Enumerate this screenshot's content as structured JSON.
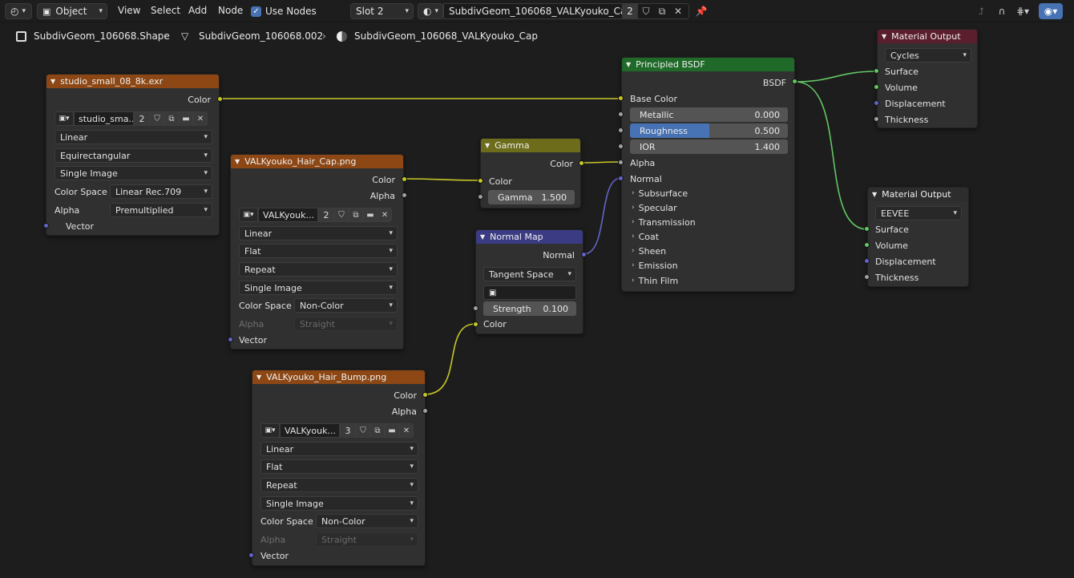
{
  "header": {
    "mode": "Object",
    "menus": [
      "View",
      "Select",
      "Add",
      "Node"
    ],
    "use_nodes": "Use Nodes",
    "slot": "Slot 2",
    "material_name": "SubdivGeom_106068_VALKyouko_Cap",
    "material_users": "2"
  },
  "breadcrumb": [
    "SubdivGeom_106068.Shape",
    "SubdivGeom_106068.002",
    "SubdivGeom_106068_VALKyouko_Cap"
  ],
  "nodes": {
    "env": {
      "title": "studio_small_08_8k.exr",
      "out_color": "Color",
      "image_name": "studio_sma...",
      "users": "2",
      "interpolation": "Linear",
      "projection": "Equirectangular",
      "source": "Single Image",
      "color_space_label": "Color Space",
      "color_space": "Linear Rec.709",
      "alpha_label": "Alpha",
      "alpha": "Premultiplied",
      "in_vector": "Vector"
    },
    "cap": {
      "title": "VALKyouko_Hair_Cap.png",
      "out_color": "Color",
      "out_alpha": "Alpha",
      "image_name": "VALKyouk...",
      "users": "2",
      "interpolation": "Linear",
      "projection": "Flat",
      "extension": "Repeat",
      "source": "Single Image",
      "color_space_label": "Color Space",
      "color_space": "Non-Color",
      "alpha_label": "Alpha",
      "alpha": "Straight",
      "in_vector": "Vector"
    },
    "bump": {
      "title": "VALKyouko_Hair_Bump.png",
      "out_color": "Color",
      "out_alpha": "Alpha",
      "image_name": "VALKyouk...",
      "users": "3",
      "interpolation": "Linear",
      "projection": "Flat",
      "extension": "Repeat",
      "source": "Single Image",
      "color_space_label": "Color Space",
      "color_space": "Non-Color",
      "alpha_label": "Alpha",
      "alpha": "Straight",
      "in_vector": "Vector"
    },
    "gamma": {
      "title": "Gamma",
      "out_color": "Color",
      "in_color": "Color",
      "gamma_label": "Gamma",
      "gamma_value": "1.500"
    },
    "normal_map": {
      "title": "Normal Map",
      "out_normal": "Normal",
      "space": "Tangent Space",
      "strength_label": "Strength",
      "strength_value": "0.100",
      "in_color": "Color"
    },
    "bsdf": {
      "title": "Principled BSDF",
      "out_bsdf": "BSDF",
      "base_color": "Base Color",
      "metallic_label": "Metallic",
      "metallic_value": "0.000",
      "roughness_label": "Roughness",
      "roughness_value": "0.500",
      "roughness_fraction": 0.5,
      "ior_label": "IOR",
      "ior_value": "1.400",
      "alpha": "Alpha",
      "normal": "Normal",
      "panels": [
        "Subsurface",
        "Specular",
        "Transmission",
        "Coat",
        "Sheen",
        "Emission",
        "Thin Film"
      ]
    },
    "out_cycles": {
      "title": "Material Output",
      "target": "Cycles",
      "surface": "Surface",
      "volume": "Volume",
      "displacement": "Displacement",
      "thickness": "Thickness"
    },
    "out_eevee": {
      "title": "Material Output",
      "target": "EEVEE",
      "surface": "Surface",
      "volume": "Volume",
      "displacement": "Displacement",
      "thickness": "Thickness"
    }
  },
  "colors": {
    "texture_header": "#8c4714",
    "shader_header": "#1f6a29",
    "color_header": "#6c6c1b",
    "vector_header": "#3b3b84",
    "output_header": "#5a1e2c",
    "socket_color": "#c7c729",
    "socket_float": "#a1a1a1",
    "socket_vector": "#6363c7",
    "socket_shader": "#63c763",
    "accent": "#4772b3"
  }
}
